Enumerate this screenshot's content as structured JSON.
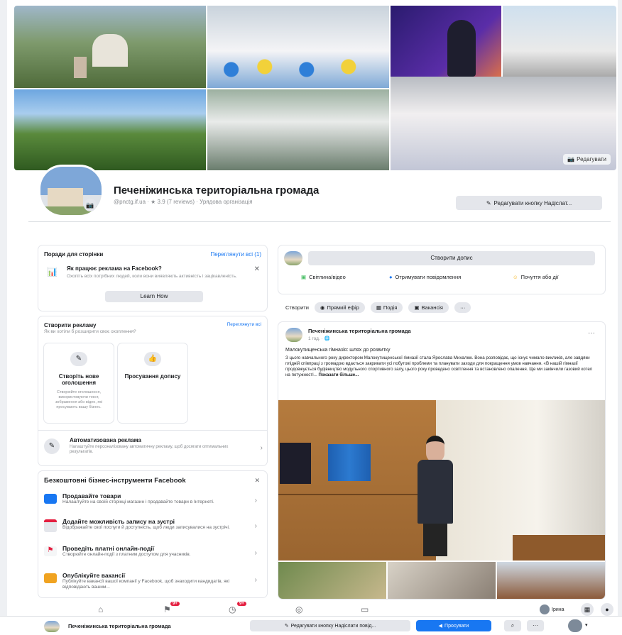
{
  "page": {
    "name": "Печеніжинська територіальна громада",
    "subtitle": "@pnctg.if.ua · ★ 3.9 (7 reviews) · Урядова організація",
    "edit_cover": "Редагувати",
    "edit_send_button": "Редагувати кнопку Надіслат..."
  },
  "tips": {
    "title": "Поради для сторінки",
    "see_all": "Переглянути всі (1)",
    "item_title": "Як працює реклама на Facebook?",
    "item_text": "Охопіть всіх потрібних людей, коли вони виявляють активність і зацікавленість.",
    "learn_more": "Learn How"
  },
  "ads": {
    "title": "Створити рекламу",
    "subtitle": "Як ви хотіли б розширити своє охоплення?",
    "see_all": "Переглянути всі",
    "option1_title": "Створіть нове оголошення",
    "option1_text": "Створюйте оголошення, використовуючи текст, зображення або відео, які просувають вашу бізнес.",
    "option2_title": "Просування допису",
    "auto_title": "Автоматизована реклама",
    "auto_text": "Налаштуйте персоналізовану автоматичну рекламу, щоб досягати оптимальних результатів."
  },
  "tools": {
    "title": "Безкоштовні бізнес-інструменти Facebook",
    "items": [
      {
        "title": "Продавайте товари",
        "text": "Налаштуйте на своїй сторінці магазин і продавайте товари в Інтернеті."
      },
      {
        "title": "Додайте можливість запису на зустрі",
        "text": "Відображайте свої послуги й доступність, щоб люди записувалися на зустрічі."
      },
      {
        "title": "Проведіть платні онлайн-події",
        "text": "Створюйте онлайн-події з платним доступом для учасників."
      },
      {
        "title": "Опублікуйте вакансії",
        "text": "Публікуйте вакансії вашої компанії у Facebook, щоб знаходити кандидатів, які відповідають вашим..."
      }
    ]
  },
  "composer": {
    "create_post": "Створити допис",
    "photo_video": "Світлина/відео",
    "mention": "Отримувати повідомлення",
    "feeling": "Почуття або дії",
    "create_label": "Створити",
    "live": "Прямий ефір",
    "event": "Подія",
    "job": "Вакансія"
  },
  "post": {
    "author": "Печеніжинська територіальна громада",
    "time": "1 год. · 🌐",
    "headline": "Малокутищенська гімназія: шлях до розвитку",
    "body": "З цього навчального року директором Малокутищенської гімназії стала Ярослава Михалюк. Вона розповідає, що існує чимало викликів, але завдяки плідній співпраці з громадою вдається закривати усі побутові проблеми та планувати заходи для покращення умов навчання. «В нашій гімназії продовжується будівництво модульного спортивного залу, цього року проведено освітлення та встановлено опалення. Ще ми закінчили газовий котел на потужності...",
    "see_more": "Показати більше..."
  },
  "nav": {
    "badge1": "9+",
    "badge2": "9+",
    "profile_label": "Ірина"
  },
  "bottom": {
    "name": "Печеніжинська територіальна громада",
    "edit_button": "Редагувати кнопку Надіслати повід...",
    "promote": "Просувати"
  },
  "colors": {
    "brand": "#1877f2",
    "badge": "#e41e3f"
  }
}
